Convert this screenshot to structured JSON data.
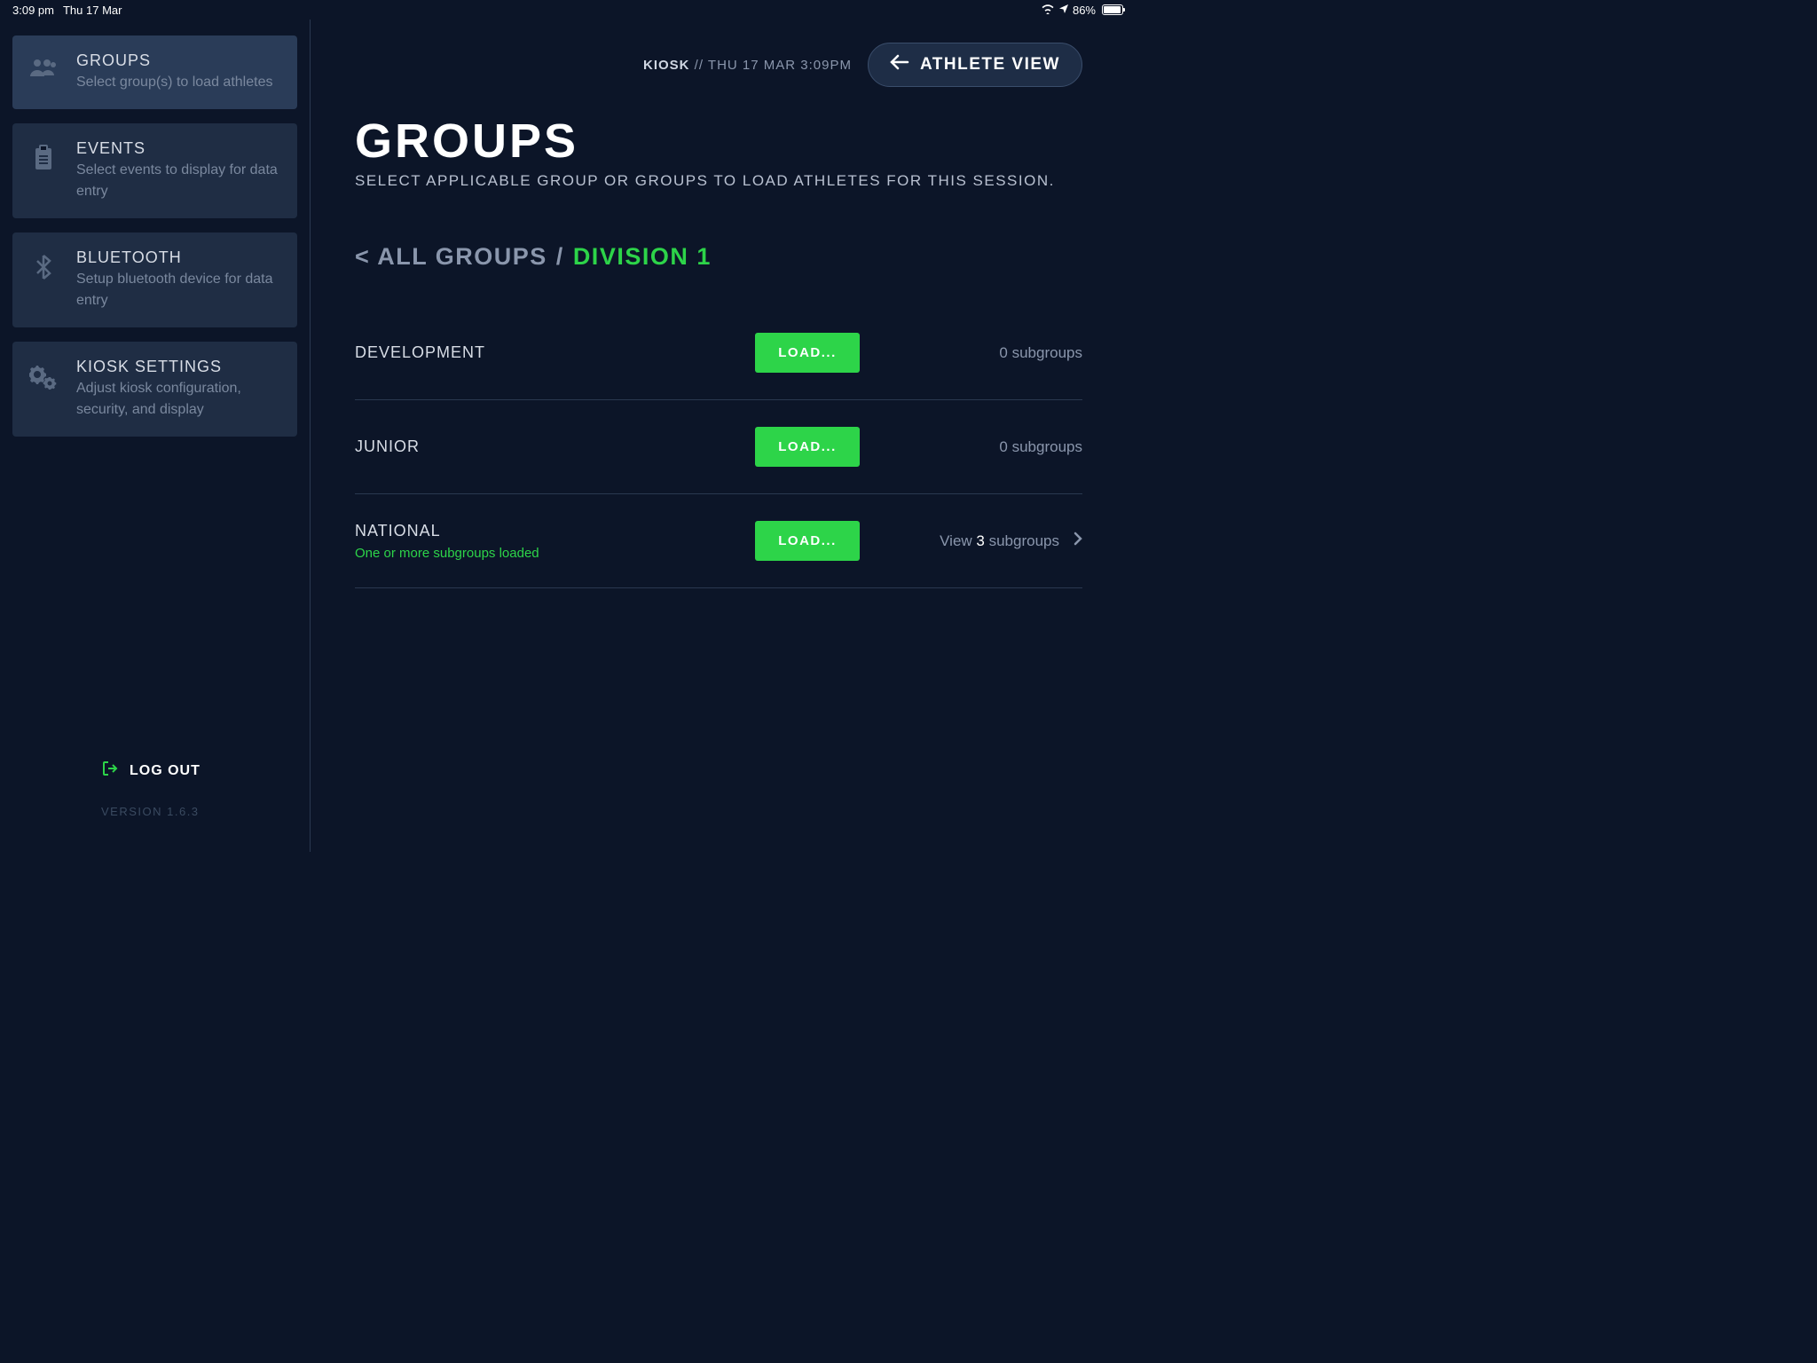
{
  "status_bar": {
    "time": "3:09 pm",
    "date": "Thu 17 Mar",
    "battery": "86%"
  },
  "sidebar": {
    "items": [
      {
        "title": "GROUPS",
        "subtitle": "Select group(s) to load athletes"
      },
      {
        "title": "EVENTS",
        "subtitle": "Select events to display for data entry"
      },
      {
        "title": "BLUETOOTH",
        "subtitle": "Setup bluetooth device for data entry"
      },
      {
        "title": "KIOSK SETTINGS",
        "subtitle": "Adjust kiosk configuration, security, and display"
      }
    ],
    "logout_label": "LOG OUT",
    "version_label": "VERSION 1.6.3"
  },
  "header": {
    "kiosk_label": "KIOSK",
    "separator": " // ",
    "datetime": "THU 17 MAR 3:09PM",
    "athlete_view_label": "ATHLETE VIEW"
  },
  "page": {
    "title": "GROUPS",
    "subtitle": "SELECT APPLICABLE GROUP OR GROUPS TO LOAD ATHLETES FOR THIS SESSION."
  },
  "breadcrumb": {
    "back_label": "< ALL GROUPS",
    "separator": "/",
    "current": "DIVISION 1"
  },
  "groups": [
    {
      "name": "DEVELOPMENT",
      "load_label": "LOAD...",
      "subgroup_text": "0 subgroups",
      "has_chevron": false
    },
    {
      "name": "JUNIOR",
      "load_label": "LOAD...",
      "subgroup_text": "0 subgroups",
      "has_chevron": false
    },
    {
      "name": "NATIONAL",
      "substatus": "One or more subgroups loaded",
      "load_label": "LOAD...",
      "subgroup_prefix": "View ",
      "subgroup_count": "3",
      "subgroup_suffix": " subgroups",
      "has_chevron": true
    }
  ]
}
